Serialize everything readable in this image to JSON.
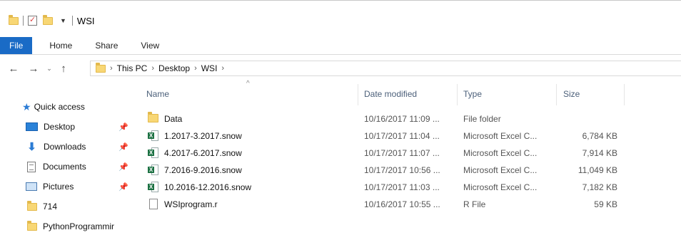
{
  "window": {
    "title": "WSI"
  },
  "ribbon": {
    "tabs": [
      "File",
      "Home",
      "Share",
      "View"
    ]
  },
  "address": {
    "nav": {
      "back": "←",
      "forward": "→",
      "recent": "⌄",
      "up": "↑"
    },
    "crumbs": [
      "This PC",
      "Desktop",
      "WSI"
    ],
    "separator": "›"
  },
  "navpane": {
    "items": [
      {
        "label": "Quick access",
        "icon": "star-icon"
      },
      {
        "label": "Desktop",
        "icon": "desktop-icon",
        "pinned": true
      },
      {
        "label": "Downloads",
        "icon": "downloads-icon",
        "pinned": true
      },
      {
        "label": "Documents",
        "icon": "documents-icon",
        "pinned": true
      },
      {
        "label": "Pictures",
        "icon": "pictures-icon",
        "pinned": true
      },
      {
        "label": "714",
        "icon": "folder-icon"
      },
      {
        "label": "PythonProgrammir",
        "icon": "folder-icon"
      }
    ],
    "pin_glyph": "📌"
  },
  "columns": {
    "name": "Name",
    "date": "Date modified",
    "type": "Type",
    "size": "Size",
    "sort_glyph": "^"
  },
  "files": [
    {
      "name": "Data",
      "date": "10/16/2017 11:09 ...",
      "type": "File folder",
      "size": "",
      "icon": "folder-icon"
    },
    {
      "name": "1.2017-3.2017.snow",
      "date": "10/17/2017 11:04 ...",
      "type": "Microsoft Excel C...",
      "size": "6,784 KB",
      "icon": "excel-csv-icon"
    },
    {
      "name": "4.2017-6.2017.snow",
      "date": "10/17/2017 11:07 ...",
      "type": "Microsoft Excel C...",
      "size": "7,914 KB",
      "icon": "excel-csv-icon"
    },
    {
      "name": "7.2016-9.2016.snow",
      "date": "10/17/2017 10:56 ...",
      "type": "Microsoft Excel C...",
      "size": "11,049 KB",
      "icon": "excel-csv-icon"
    },
    {
      "name": "10.2016-12.2016.snow",
      "date": "10/17/2017 11:03 ...",
      "type": "Microsoft Excel C...",
      "size": "7,182 KB",
      "icon": "excel-csv-icon"
    },
    {
      "name": "WSIprogram.r",
      "date": "10/16/2017 10:55 ...",
      "type": "R File",
      "size": "59 KB",
      "icon": "file-icon"
    }
  ],
  "colors": {
    "accent": "#1a6bc6",
    "folder": "#f8d775",
    "excel": "#1d7244"
  }
}
